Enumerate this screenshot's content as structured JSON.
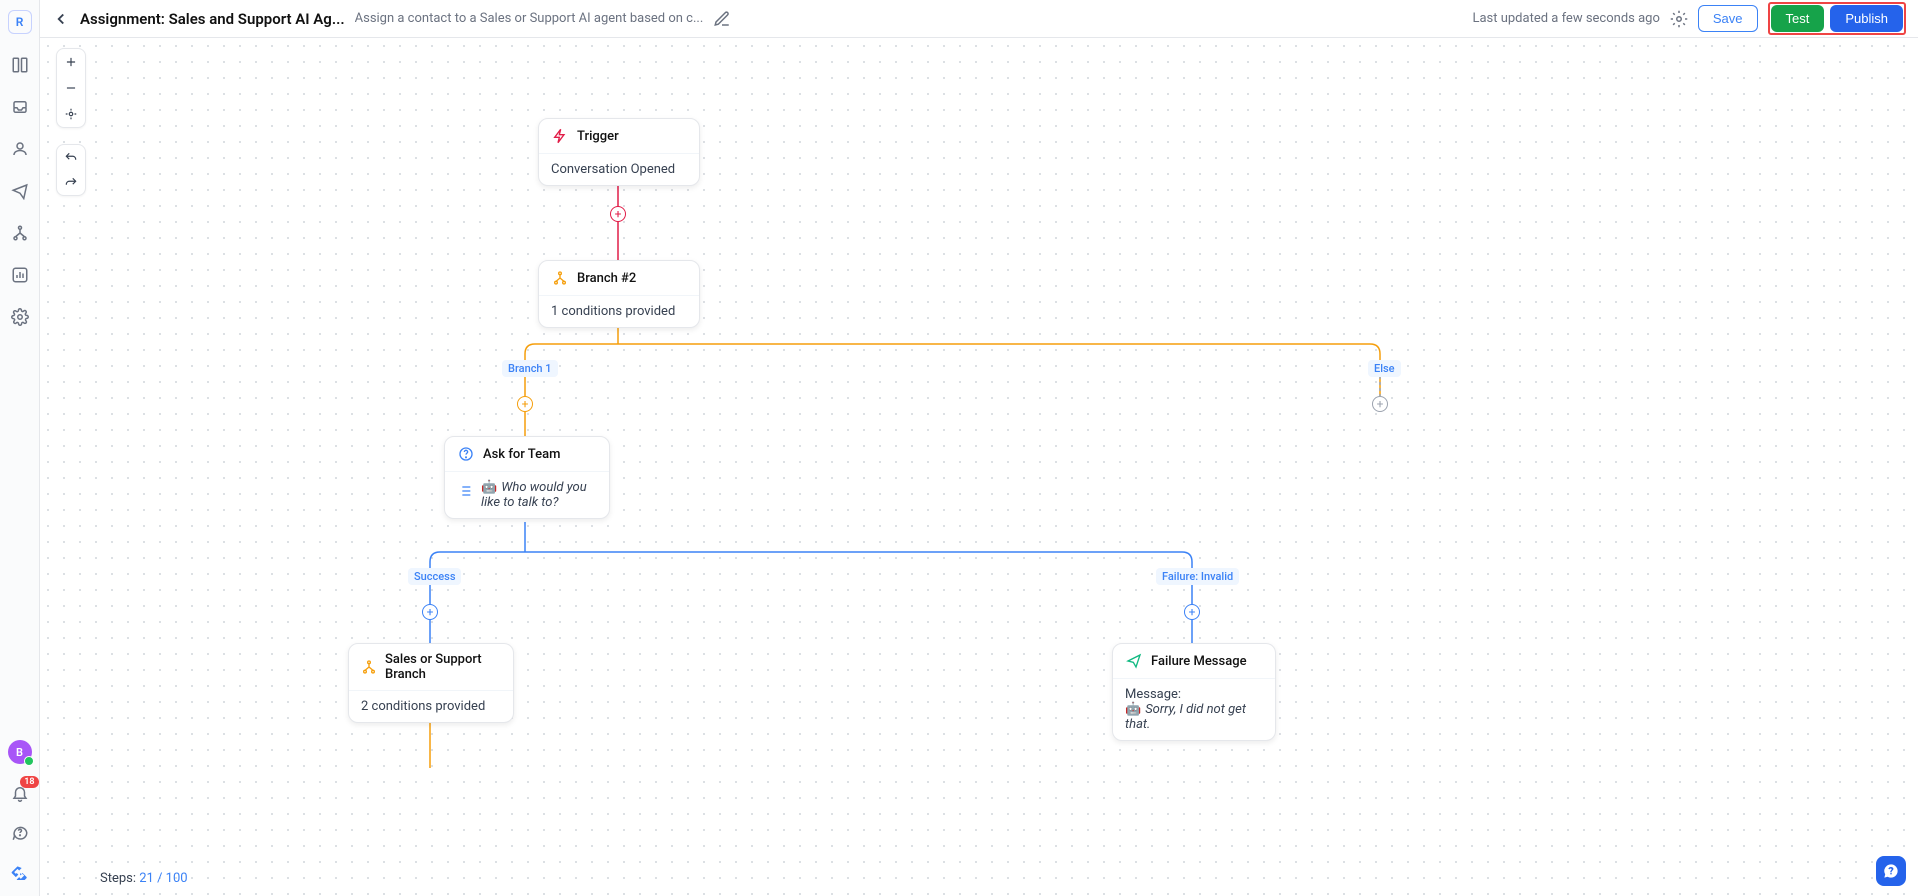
{
  "left_rail": {
    "logo_letter": "R",
    "notifications_count": "18",
    "avatar_letter": "B"
  },
  "header": {
    "title": "Assignment: Sales and Support AI Ag...",
    "description": "Assign a contact to a Sales or Support AI agent based on c...",
    "last_updated": "Last updated a few seconds ago",
    "save": "Save",
    "test": "Test",
    "publish": "Publish"
  },
  "steps": {
    "label": "Steps: ",
    "count": "21 / 100"
  },
  "nodes": {
    "trigger": {
      "title": "Trigger",
      "body": "Conversation Opened"
    },
    "branch2": {
      "title": "Branch #2",
      "body": "1 conditions provided"
    },
    "branch_labels": {
      "branch1": "Branch 1",
      "else": "Else"
    },
    "ask": {
      "title": "Ask for Team",
      "body": "Who would you like to talk to?"
    },
    "ask_labels": {
      "success": "Success",
      "failure": "Failure: Invalid"
    },
    "sales_branch": {
      "title": "Sales or Support Branch",
      "body": "2 conditions provided"
    },
    "failure": {
      "title": "Failure Message",
      "msg_label": "Message:",
      "body": "Sorry, I did not get that."
    }
  }
}
